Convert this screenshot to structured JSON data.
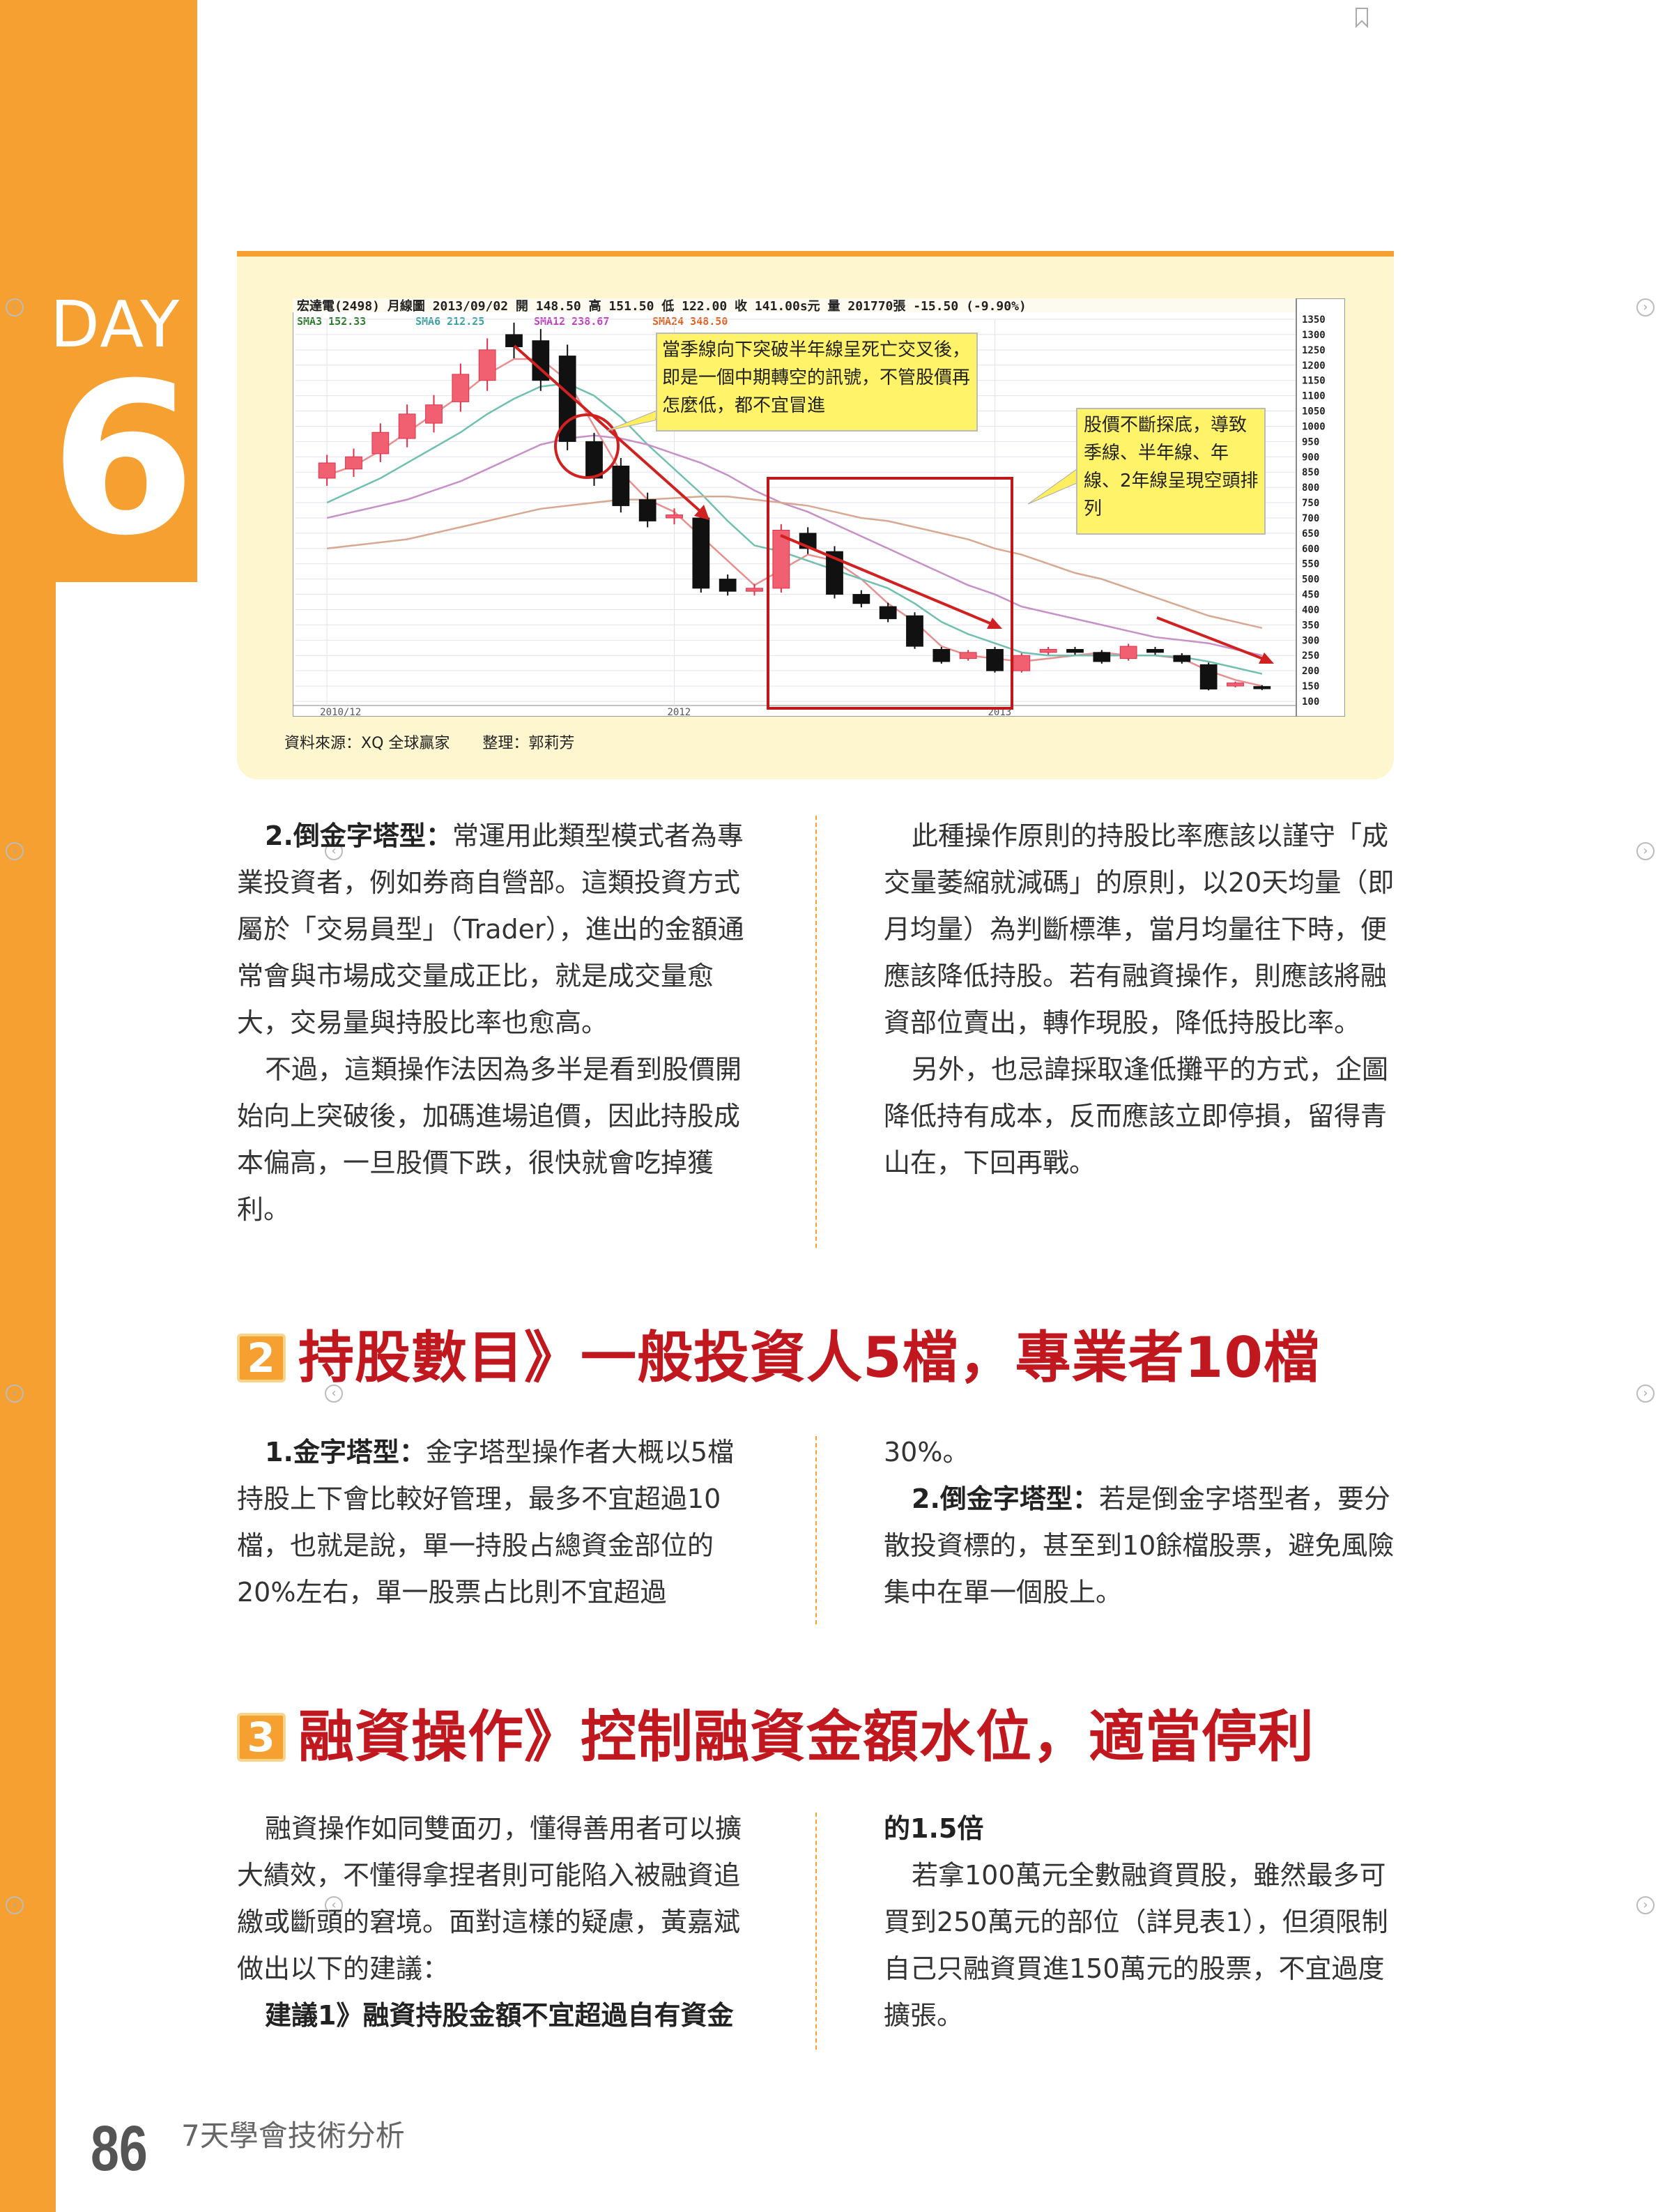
{
  "day": {
    "word": "DAY",
    "number": "6"
  },
  "chart": {
    "header": "宏達電(2498) 月線圖 2013/09/02 開 148.50 高 151.50 低 122.00 收 141.00s元 量 201770張 -15.50 (-9.90%)",
    "sma_labels": [
      "SMA3 152.33",
      "SMA6 212.25",
      "SMA12 238.67",
      "SMA24 348.50"
    ],
    "sma_colors": [
      "#2a7a2a",
      "#3aa0a0",
      "#c040c0",
      "#e06020"
    ],
    "callout_1": "當季線向下突破半年線呈死亡交叉後，即是一個中期轉空的訊號，不管股價再怎麼低，都不宜冒進",
    "callout_2": "股價不斷探底，導致季線、半年線、年線、2年線呈現空頭排列",
    "x_ticks": [
      "2010/12",
      "2012",
      "2013"
    ],
    "y_ticks": [
      "1350",
      "1300",
      "1250",
      "1200",
      "1150",
      "1100",
      "1050",
      "1000",
      "950",
      "900",
      "850",
      "800",
      "750",
      "700",
      "650",
      "600",
      "550",
      "500",
      "450",
      "400",
      "350",
      "300",
      "250",
      "200",
      "150",
      "100"
    ],
    "source": "資料來源：XQ 全球贏家",
    "editor": "整理：郭莉芳"
  },
  "chart_data": {
    "type": "candlestick",
    "title": "宏達電(2498) 月線圖",
    "ylim": [
      100,
      1350
    ],
    "candles": [
      {
        "o": 830,
        "c": 880
      },
      {
        "o": 860,
        "c": 900
      },
      {
        "o": 910,
        "c": 980
      },
      {
        "o": 960,
        "c": 1040
      },
      {
        "o": 1010,
        "c": 1070
      },
      {
        "o": 1080,
        "c": 1170
      },
      {
        "o": 1150,
        "c": 1250
      },
      {
        "o": 1300,
        "c": 1260
      },
      {
        "o": 1280,
        "c": 1150
      },
      {
        "o": 1230,
        "c": 950
      },
      {
        "o": 950,
        "c": 830
      },
      {
        "o": 870,
        "c": 740
      },
      {
        "o": 760,
        "c": 690
      },
      {
        "o": 700,
        "c": 710
      },
      {
        "o": 700,
        "c": 470
      },
      {
        "o": 500,
        "c": 460
      },
      {
        "o": 460,
        "c": 470
      },
      {
        "o": 470,
        "c": 660
      },
      {
        "o": 650,
        "c": 600
      },
      {
        "o": 590,
        "c": 450
      },
      {
        "o": 450,
        "c": 420
      },
      {
        "o": 410,
        "c": 370
      },
      {
        "o": 380,
        "c": 280
      },
      {
        "o": 270,
        "c": 230
      },
      {
        "o": 240,
        "c": 260
      },
      {
        "o": 270,
        "c": 200
      },
      {
        "o": 200,
        "c": 250
      },
      {
        "o": 260,
        "c": 270
      },
      {
        "o": 270,
        "c": 260
      },
      {
        "o": 260,
        "c": 230
      },
      {
        "o": 240,
        "c": 280
      },
      {
        "o": 270,
        "c": 260
      },
      {
        "o": 250,
        "c": 230
      },
      {
        "o": 220,
        "c": 140
      },
      {
        "o": 150,
        "c": 160
      },
      {
        "o": 148.5,
        "c": 141
      }
    ],
    "sma": {
      "SMA3": [
        840,
        870,
        920,
        980,
        1040,
        1100,
        1170,
        1220,
        1220,
        1150,
        1000,
        850,
        760,
        720,
        640,
        560,
        480,
        530,
        580,
        560,
        500,
        420,
        360,
        280,
        250,
        240,
        230,
        240,
        250,
        260,
        250,
        250,
        240,
        200,
        170,
        150
      ],
      "SMA6": [
        750,
        790,
        830,
        880,
        930,
        980,
        1040,
        1090,
        1130,
        1140,
        1100,
        1030,
        940,
        860,
        780,
        690,
        610,
        590,
        560,
        530,
        500,
        470,
        420,
        360,
        320,
        290,
        260,
        250,
        250,
        250,
        250,
        250,
        245,
        230,
        210,
        190
      ],
      "SMA12": [
        700,
        720,
        740,
        760,
        790,
        820,
        860,
        900,
        940,
        960,
        970,
        960,
        940,
        910,
        880,
        840,
        790,
        750,
        720,
        680,
        640,
        600,
        560,
        520,
        480,
        450,
        410,
        390,
        370,
        350,
        330,
        310,
        300,
        290,
        270,
        250
      ],
      "SMA24": [
        600,
        610,
        620,
        630,
        650,
        670,
        690,
        710,
        730,
        740,
        750,
        760,
        760,
        765,
        770,
        770,
        760,
        750,
        740,
        720,
        700,
        690,
        670,
        650,
        630,
        600,
        580,
        550,
        520,
        500,
        470,
        440,
        410,
        380,
        360,
        340
      ]
    }
  },
  "col1": {
    "p1_lead": "2.倒金字塔型：",
    "p1_text": "常運用此類型模式者為專業投資者，例如券商自營部。這類投資方式屬於「交易員型」（Trader），進出的金額通常會與市場成交量成正比，就是成交量愈大，交易量與持股比率也愈高。",
    "p2_text": "不過，這類操作法因為多半是看到股價開始向上突破後，加碼進場追價，因此持股成本偏高，一旦股價下跌，很快就會吃掉獲利。"
  },
  "col2": {
    "p1_text": "此種操作原則的持股比率應該以謹守「成交量萎縮就減碼」的原則，以20天均量（即月均量）為判斷標準，當月均量往下時，便應該降低持股。若有融資操作，則應該將融資部位賣出，轉作現股，降低持股比率。",
    "p2_text": "另外，也忌諱採取逢低攤平的方式，企圖降低持有成本，反而應該立即停損，留得青山在，下回再戰。"
  },
  "section2": {
    "badge": "2",
    "title": "持股數目》一般投資人5檔，專業者10檔",
    "col1_lead": "1.金字塔型：",
    "col1_text": "金字塔型操作者大概以5檔持股上下會比較好管理，最多不宜超過10檔，也就是說，單一持股占總資金部位的20%左右，單一股票占比則不宜超過",
    "col2_cont": "30%。",
    "col2_lead": "2.倒金字塔型：",
    "col2_text": "若是倒金字塔型者，要分散投資標的，甚至到10餘檔股票，避免風險集中在單一個股上。"
  },
  "section3": {
    "badge": "3",
    "title": "融資操作》控制融資金額水位，適當停利",
    "col1_p1": "融資操作如同雙面刃，懂得善用者可以擴大績效，不懂得拿捏者則可能陷入被融資追繳或斷頭的窘境。面對這樣的疑慮，黃嘉斌做出以下的建議：",
    "col1_p2": "建議1》融資持股金額不宜超過自有資金",
    "col2_cont": "的1.5倍",
    "col2_p1": "若拿100萬元全數融資買股，雖然最多可買到250萬元的部位（詳見表1），但須限制自己只融資買進150萬元的股票，不宜過度擴張。"
  },
  "footer": {
    "page_number": "86",
    "book_title": "7天學會技術分析"
  }
}
